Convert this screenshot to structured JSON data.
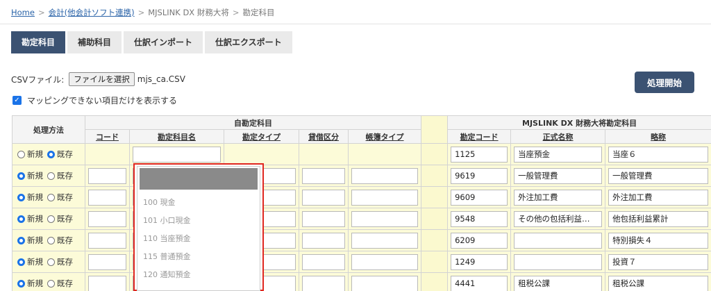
{
  "breadcrumb": {
    "home": "Home",
    "accounting": "会計(他会計ソフト連携)",
    "mjs": "MJSLINK DX 財務大将",
    "current": "勘定科目",
    "separator": ">"
  },
  "tabs": [
    "勘定科目",
    "補助科目",
    "仕訳インポート",
    "仕訳エクスポート"
  ],
  "csv": {
    "label": "CSVファイル:",
    "button": "ファイルを選択",
    "filename": "mjs_ca.CSV"
  },
  "filter": {
    "label": "マッピングできない項目だけを表示する",
    "checked": true
  },
  "process_button": "処理開始",
  "table": {
    "group_own": "自勘定科目",
    "group_mjs": "MJSLINK DX 財務大将勘定科目",
    "col_method": "処理方法",
    "own_cols": [
      "コード",
      "勘定科目名",
      "勘定タイプ",
      "貸借区分",
      "帳簿タイプ"
    ],
    "mjs_cols": [
      "勘定コード",
      "正式名称",
      "略称"
    ],
    "radio_new": "新規",
    "radio_existing": "既存",
    "rows": [
      {
        "method": "existing",
        "code": "1125",
        "name": "当座預金",
        "short": "当座６"
      },
      {
        "method": "new",
        "code": "9619",
        "name": "一般管理費",
        "short": "一般管理費"
      },
      {
        "method": "new",
        "code": "9609",
        "name": "外注加工費",
        "short": "外注加工費"
      },
      {
        "method": "new",
        "code": "9548",
        "name": "その他の包括利益…",
        "short": "他包括利益累計"
      },
      {
        "method": "new",
        "code": "6209",
        "name": "",
        "short": "特別損失４"
      },
      {
        "method": "new",
        "code": "1249",
        "name": "",
        "short": "投資７"
      },
      {
        "method": "new",
        "code": "4441",
        "name": "租税公課",
        "short": "租税公課"
      }
    ]
  },
  "dropdown": {
    "options": [
      "100 現金",
      "101 小口現金",
      "110 当座預金",
      "115 普通預金",
      "120 通知預金"
    ]
  },
  "colors": {
    "tab_active": "#3b5272",
    "highlight": "#e0261f",
    "row_bg": "#fcfbd8",
    "radio": "#1a73e8"
  }
}
